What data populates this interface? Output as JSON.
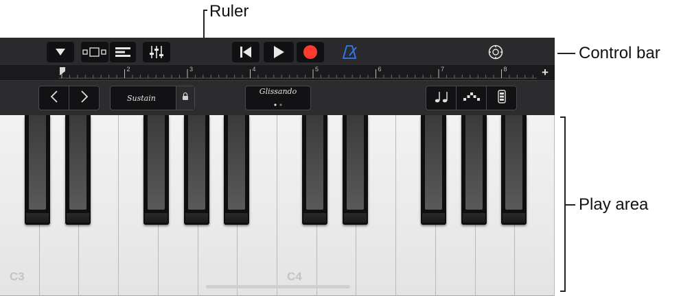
{
  "callouts": {
    "ruler": "Ruler",
    "control_bar": "Control bar",
    "play_area": "Play area"
  },
  "control_bar": {
    "buttons": [
      {
        "icon": "dropdown-triangle-icon"
      },
      {
        "icon": "browser-icon"
      },
      {
        "icon": "tracks-view-icon"
      },
      {
        "icon": "mixer-icon"
      },
      {
        "icon": "go-to-beginning-icon"
      },
      {
        "icon": "play-icon"
      },
      {
        "icon": "record-icon",
        "color": "#ff3b30"
      },
      {
        "icon": "metronome-icon",
        "color": "#2f7cf6"
      },
      {
        "icon": "settings-icon"
      }
    ]
  },
  "ruler": {
    "ticks": [
      "1",
      "2",
      "3",
      "4",
      "5",
      "6",
      "7",
      "8"
    ],
    "add_label": "+"
  },
  "controls": {
    "octave_down_icon": "chevron-left-icon",
    "octave_up_icon": "chevron-right-icon",
    "sustain_label": "Sustain",
    "lock_icon": "lock-icon",
    "glissando_label": "Glissando",
    "right_icons": [
      "notes-icon",
      "arpeggiator-icon",
      "keyboard-layout-icon"
    ]
  },
  "keyboard": {
    "white_key_count": 14,
    "labels": [
      "C3",
      "C4"
    ]
  },
  "colors": {
    "record": "#ff3b30",
    "metronome": "#2f7cf6",
    "app_background": "#1c1c1e"
  }
}
